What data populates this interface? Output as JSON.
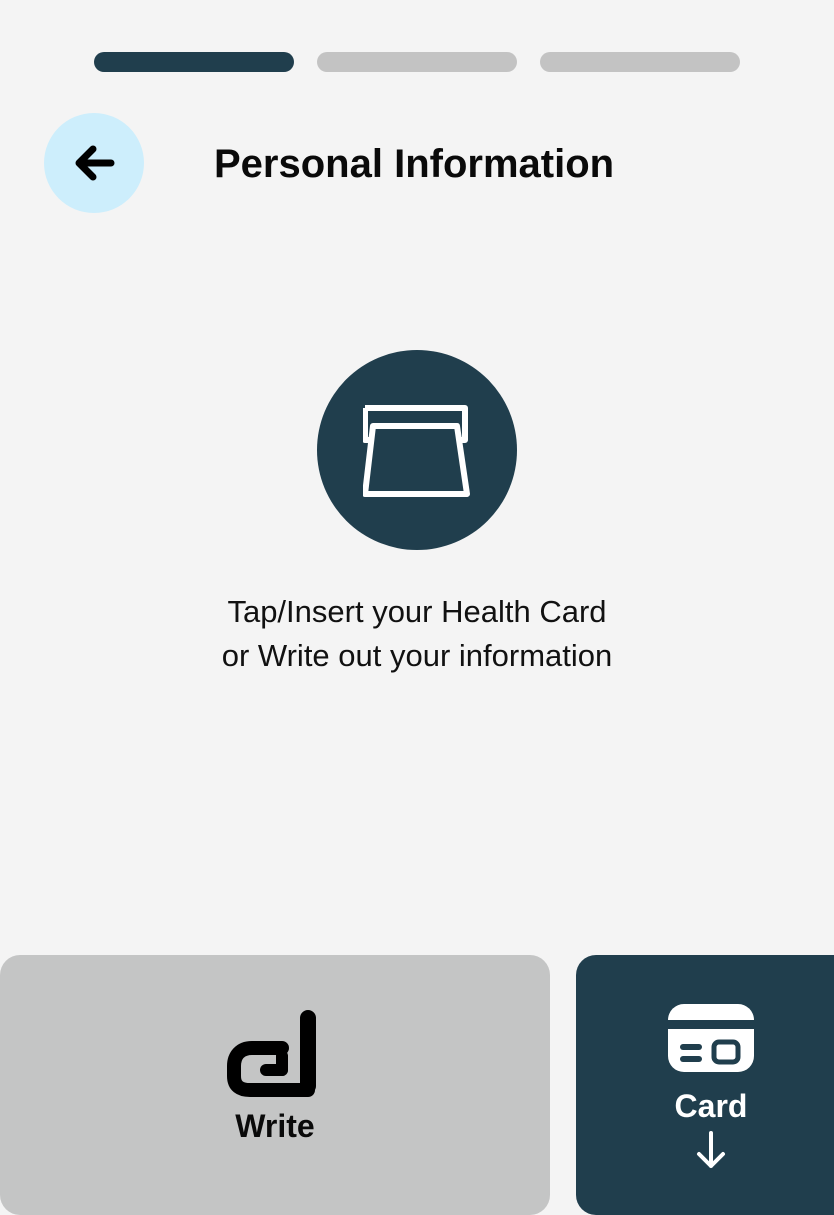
{
  "progress": {
    "total_steps": 3,
    "current_step": 1
  },
  "header": {
    "title": "Personal Information",
    "back_icon": "arrow-left-icon"
  },
  "hero": {
    "icon": "card-slot-icon",
    "instruction": "Tap/Insert your Health Card or Write out your information"
  },
  "actions": {
    "write": {
      "label": "Write",
      "icon": "pen-write-icon"
    },
    "card": {
      "label": "Card",
      "icon": "credit-card-icon",
      "indicator_icon": "arrow-down-icon"
    }
  },
  "colors": {
    "background": "#f4f4f4",
    "primary_dark": "#203e4d",
    "progress_inactive": "#c3c3c3",
    "back_button": "#cdeefc",
    "write_button": "#c4c5c5"
  }
}
